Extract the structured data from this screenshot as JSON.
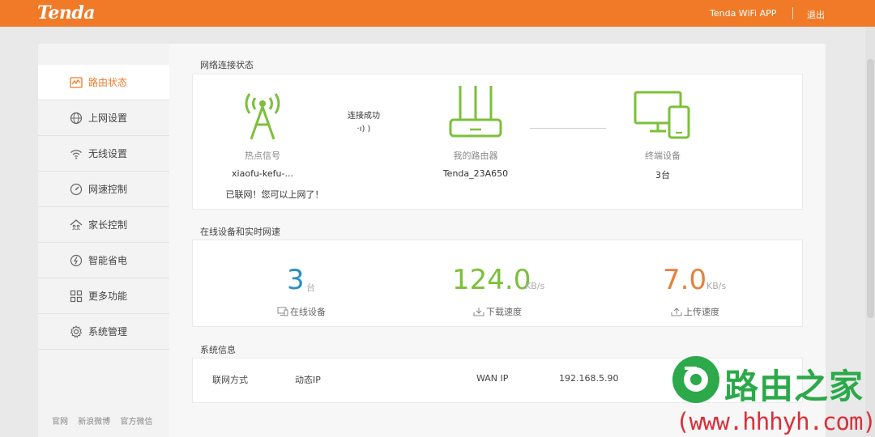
{
  "header": {
    "brand": "Tenda",
    "app_link": "Tenda WiFi APP",
    "logout": "退出"
  },
  "sidebar": {
    "items": [
      {
        "label": "路由状态",
        "icon": "status-chart-icon",
        "active": true
      },
      {
        "label": "上网设置",
        "icon": "globe-icon",
        "active": false
      },
      {
        "label": "无线设置",
        "icon": "wifi-icon",
        "active": false
      },
      {
        "label": "网速控制",
        "icon": "speedometer-icon",
        "active": false
      },
      {
        "label": "家长控制",
        "icon": "house-family-icon",
        "active": false
      },
      {
        "label": "智能省电",
        "icon": "power-saving-icon",
        "active": false
      },
      {
        "label": "更多功能",
        "icon": "grid-apps-icon",
        "active": false
      },
      {
        "label": "系统管理",
        "icon": "gear-icon",
        "active": false
      }
    ],
    "footer_links": [
      "官网",
      "新浪微博",
      "官方微信"
    ]
  },
  "network_status": {
    "section_title": "网络连接状态",
    "hotspot": {
      "label": "热点信号",
      "name": "xiaofu-kefu-...",
      "message": "已联网！您可以上网了！"
    },
    "connection": {
      "status": "连接成功",
      "signal_glyph": "·ı) )"
    },
    "router": {
      "label": "我的路由器",
      "name": "Tenda_23A650"
    },
    "terminals": {
      "label": "终端设备",
      "count": "3台"
    }
  },
  "realtime": {
    "section_title": "在线设备和实时网速",
    "online": {
      "value": "3",
      "unit": "台",
      "label": "在线设备"
    },
    "download": {
      "value": "124.0",
      "unit": "KB/s",
      "label": "下载速度"
    },
    "upload": {
      "value": "7.0",
      "unit": "KB/s",
      "label": "上传速度"
    }
  },
  "system_info": {
    "section_title": "系统信息",
    "connection_type_label": "联网方式",
    "connection_type_value": "动态IP",
    "wan_ip_label": "WAN IP",
    "wan_ip_value": "192.168.5.90"
  },
  "watermark": {
    "text": "路由之家",
    "url": "(www.hhhyh.com)"
  },
  "colors": {
    "brand_orange": "#f07a28",
    "green": "#7cc039",
    "blue": "#2a8fc6",
    "orange_value": "#e8803a"
  }
}
